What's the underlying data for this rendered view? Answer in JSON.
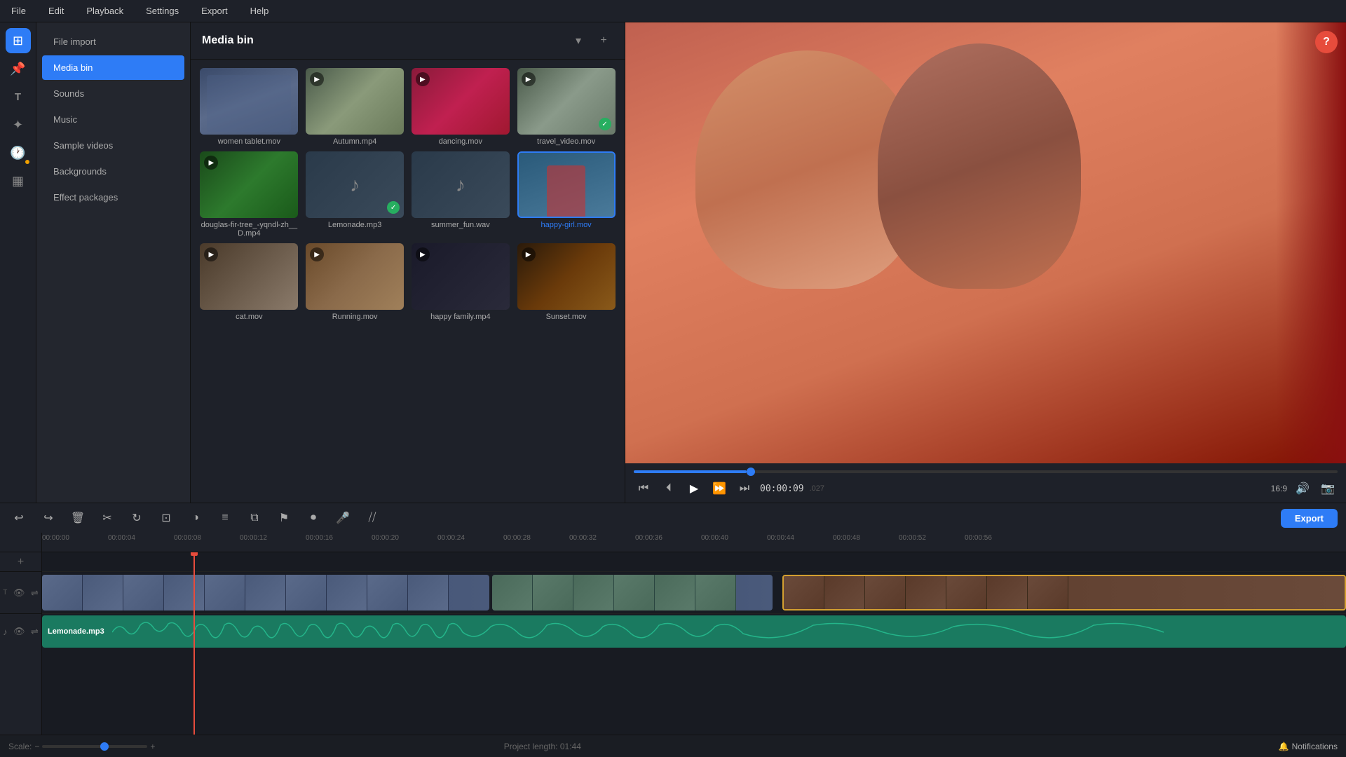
{
  "menu": {
    "items": [
      "File",
      "Edit",
      "Playback",
      "Settings",
      "Export",
      "Help"
    ]
  },
  "icon_sidebar": {
    "icons": [
      {
        "name": "home-icon",
        "symbol": "⊞",
        "active": true
      },
      {
        "name": "pin-icon",
        "symbol": "📌",
        "active": false
      },
      {
        "name": "text-icon",
        "symbol": "T",
        "active": false
      },
      {
        "name": "effects-icon",
        "symbol": "✦",
        "active": false
      },
      {
        "name": "clock-icon",
        "symbol": "🕐",
        "active": false,
        "dot": true
      },
      {
        "name": "grid-icon",
        "symbol": "▦",
        "active": false
      }
    ]
  },
  "left_panel": {
    "items": [
      {
        "label": "File import",
        "active": false
      },
      {
        "label": "Media bin",
        "active": true
      },
      {
        "label": "Sounds",
        "active": false
      },
      {
        "label": "Music",
        "active": false
      },
      {
        "label": "Sample videos",
        "active": false
      },
      {
        "label": "Backgrounds",
        "active": false
      },
      {
        "label": "Effect packages",
        "active": false
      }
    ]
  },
  "media_bin": {
    "title": "Media bin",
    "items": [
      {
        "name": "women tablet.mov",
        "type": "video",
        "has_check": true,
        "check_color": "blue",
        "thumb_class": "thumb-blue-gray"
      },
      {
        "name": "Autumn.mp4",
        "type": "video",
        "has_check": false,
        "thumb_class": "thumb-travel"
      },
      {
        "name": "dancing.mov",
        "type": "video",
        "has_check": false,
        "thumb_class": "thumb-dancing"
      },
      {
        "name": "travel_video.mov",
        "type": "video",
        "has_check": true,
        "check_color": "green",
        "thumb_class": "thumb-travel"
      },
      {
        "name": "douglas-fir-tree_-yqndl-zh__D.mp4",
        "type": "video",
        "has_check": false,
        "thumb_class": "thumb-green"
      },
      {
        "name": "Lemonade.mp3",
        "type": "audio",
        "has_check": true,
        "check_color": "green",
        "thumb_class": "thumb-blue-gray"
      },
      {
        "name": "summer_fun.wav",
        "type": "audio",
        "has_check": false,
        "thumb_class": "thumb-blue-gray"
      },
      {
        "name": "happy-girl.mov",
        "type": "video",
        "selected": true,
        "has_check": false,
        "thumb_class": "thumb-blue-gray"
      },
      {
        "name": "cat.mov",
        "type": "video",
        "has_check": false,
        "thumb_class": "thumb-cat"
      },
      {
        "name": "Running.mov",
        "type": "video",
        "has_check": false,
        "thumb_class": "thumb-running"
      },
      {
        "name": "happy family.mp4",
        "type": "video",
        "has_check": false,
        "thumb_class": "thumb-family"
      },
      {
        "name": "Sunset.mov",
        "type": "video",
        "has_check": false,
        "thumb_class": "thumb-sunset"
      }
    ]
  },
  "preview": {
    "time_current": "00:00:09",
    "time_sub": ".027",
    "time_total": "",
    "aspect_ratio": "16:9",
    "help_label": "?"
  },
  "toolbar": {
    "export_label": "Export"
  },
  "timeline": {
    "ruler_marks": [
      "00:00:00",
      "00:00:04",
      "00:00:08",
      "00:00:12",
      "00:00:16",
      "00:00:20",
      "00:00:24",
      "00:00:28",
      "00:00:32",
      "00:00:36",
      "00:00:40",
      "00:00:44",
      "00:00:48",
      "00:00:52",
      "00:00:56"
    ],
    "audio_track_label": "Lemonade.mp3"
  },
  "scale": {
    "label": "Scale:",
    "project_length_label": "Project length:",
    "project_length_value": "01:44",
    "notifications_label": "Notifications"
  }
}
